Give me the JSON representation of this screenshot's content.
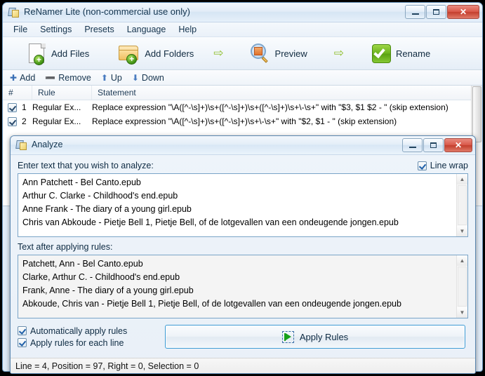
{
  "app": {
    "title": "ReNamer Lite (non-commercial use only)",
    "icon": "app-icon",
    "window_buttons": {
      "minimize": "minimize",
      "maximize": "maximize",
      "close": "close"
    }
  },
  "menubar": {
    "items": [
      {
        "label": "File"
      },
      {
        "label": "Settings"
      },
      {
        "label": "Presets"
      },
      {
        "label": "Language"
      },
      {
        "label": "Help"
      }
    ]
  },
  "toolbar": {
    "add_files": "Add Files",
    "add_folders": "Add Folders",
    "preview": "Preview",
    "rename": "Rename",
    "arrow_glyph": "⇨"
  },
  "rules_toolbar": {
    "add": "Add",
    "remove": "Remove",
    "up": "Up",
    "down": "Down",
    "add_glyph": "✚",
    "remove_glyph": "➖",
    "up_glyph": "⬆",
    "down_glyph": "⬇"
  },
  "rules_list": {
    "columns": [
      "#",
      "Rule",
      "Statement"
    ],
    "rows": [
      {
        "checked": true,
        "num": "1",
        "rule": "Regular Ex...",
        "statement": "Replace expression \"\\A([^-\\s]+)\\s+([^-\\s]+)\\s+([^-\\s]+)\\s+\\-\\s+\" with \"$3, $1 $2 - \" (skip extension)"
      },
      {
        "checked": true,
        "num": "2",
        "rule": "Regular Ex...",
        "statement": "Replace expression \"\\A([^-\\s]+)\\s+([^-\\s]+)\\s+\\-\\s+\" with \"$2, $1 - \" (skip extension)"
      }
    ]
  },
  "dialog": {
    "title": "Analyze",
    "icon": "app-icon",
    "window_buttons": {
      "minimize": "minimize",
      "maximize": "maximize",
      "close": "close"
    },
    "input_label": "Enter text that you wish to analyze:",
    "line_wrap": {
      "label": "Line wrap",
      "checked": true
    },
    "input_lines": [
      "Ann Patchett - Bel Canto.epub",
      "Arthur C. Clarke - Childhood's end.epub",
      "Anne Frank - The diary of a young girl.epub",
      "Chris van Abkoude - Pietje Bell 1, Pietje Bell, of de lotgevallen van een ondeugende jongen.epub"
    ],
    "output_label": "Text after applying rules:",
    "output_lines": [
      "Patchett, Ann - Bel Canto.epub",
      "Clarke, Arthur C. - Childhood's end.epub",
      "Frank, Anne - The diary of a young girl.epub",
      "Abkoude, Chris van - Pietje Bell 1, Pietje Bell, of de lotgevallen van een ondeugende jongen.epub"
    ],
    "options": [
      {
        "label": "Automatically apply rules",
        "checked": true
      },
      {
        "label": "Apply rules for each line",
        "checked": true
      }
    ],
    "apply_button": "Apply Rules",
    "status": "Line = 4, Position = 97, Right = 0, Selection = 0"
  },
  "colors": {
    "accent": "#3c9bd4",
    "close_red": "#c33e2d",
    "green": "#6cb31c",
    "title_text": "#12344f"
  }
}
